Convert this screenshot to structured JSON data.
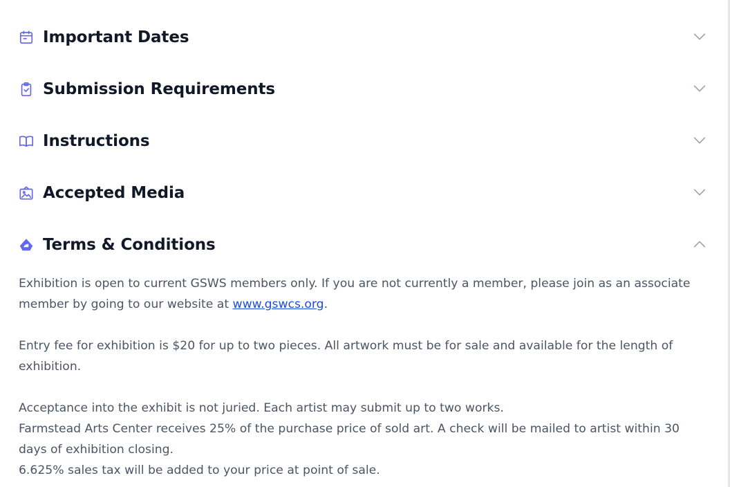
{
  "colors": {
    "accent": "#6366f1",
    "chevron": "#9ca3af",
    "heading": "#111827",
    "body_text": "#4b5563",
    "link": "#1d4ed8"
  },
  "sections": [
    {
      "label": "Important Dates",
      "icon": "calendar-icon",
      "expanded": false
    },
    {
      "label": "Submission Requirements",
      "icon": "clipboard-check-icon",
      "expanded": false
    },
    {
      "label": "Instructions",
      "icon": "book-open-icon",
      "expanded": false
    },
    {
      "label": "Accepted Media",
      "icon": "image-frame-icon",
      "expanded": false
    },
    {
      "label": "Terms & Conditions",
      "icon": "sailboat-icon",
      "expanded": true
    }
  ],
  "terms": {
    "p1_before_link": "Exhibition is open to current GSWS members only. If you are not currently a member, please join as an associate member by going to our website at ",
    "link_text": "www.gswcs.org",
    "p1_after_link": ".",
    "p2": "Entry fee for exhibition is $20 for up to two pieces. All artwork must be for sale and available for the length of exhibition.",
    "p3": "Acceptance into the exhibit is not juried. Each artist may submit up to two works.",
    "p4": "Farmstead Arts Center receives 25% of the purchase price of sold art. A check will be mailed to artist within 30 days of exhibition closing.",
    "p5": "6.625% sales tax will be added to your price at point of sale."
  }
}
